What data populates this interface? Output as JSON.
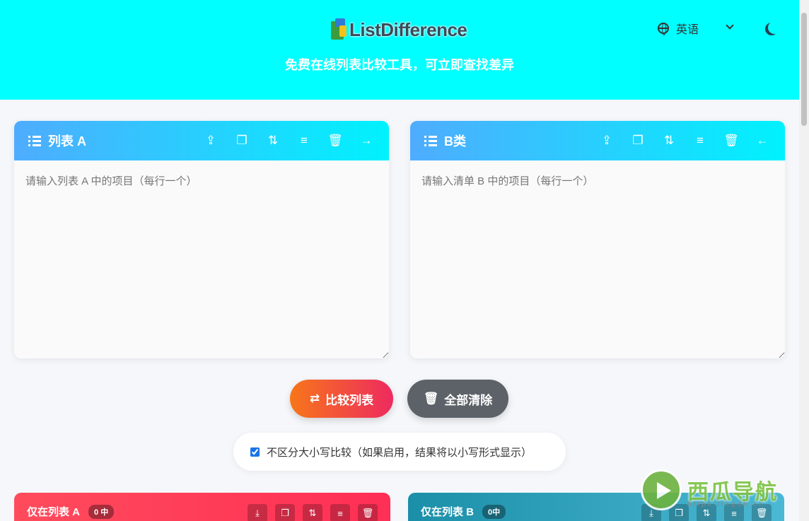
{
  "header": {
    "logo_text": "ListDifference",
    "tagline": "免费在线列表比较工具，可立即查找差异",
    "language": "英语",
    "bg_color": "#00ffff"
  },
  "icons": {
    "upload": "upload-icon",
    "copy": "copy-icon",
    "sort_asc": "sort-asc-icon",
    "sort_desc": "sort-desc-icon",
    "delete": "trash-icon",
    "arrow_right": "arrow-right-icon",
    "arrow_left": "arrow-left-icon"
  },
  "list_a": {
    "title": "列表 A",
    "placeholder": "请输入列表 A 中的项目（每行一个）",
    "value": ""
  },
  "list_b": {
    "title": "B类",
    "placeholder": "请输入清单 B 中的项目（每行一个）",
    "value": ""
  },
  "actions": {
    "compare_label": "比较列表",
    "clear_label": "全部清除"
  },
  "options": {
    "case_insensitive_label": "不区分大小写比较（如果启用，结果将以小写形式显示）",
    "case_insensitive_checked": true
  },
  "results": {
    "only_a": {
      "title": "仅在列表 A",
      "count": "0 中"
    },
    "only_b": {
      "title": "仅在列表 B",
      "count": "0中"
    }
  },
  "watermark": {
    "text": "西瓜导航",
    "url": "https://xgdh.cn"
  }
}
